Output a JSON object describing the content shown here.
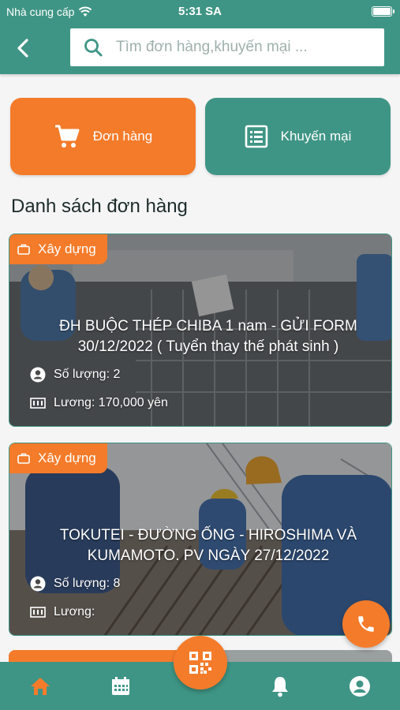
{
  "status_bar": {
    "carrier": "Nhà cung cấp",
    "time": "5:31 SA"
  },
  "header": {
    "search_placeholder": "Tìm đơn hàng,khuyến mại ..."
  },
  "quick_actions": {
    "orders_label": "Đơn hàng",
    "promotions_label": "Khuyến mại"
  },
  "section_title": "Danh sách đơn hàng",
  "orders": [
    {
      "category": "Xây dựng",
      "title": "ĐH BUỘC THÉP CHIBA 1 nam - GỬI FORM 30/12/2022 ( Tuyển thay thế phát sinh )",
      "quantity_label": "Số lượng: 2",
      "salary_label": "Lương: 170,000 yên"
    },
    {
      "category": "Xây dựng",
      "title": "TOKUTEI - ĐƯỜNG ỐNG - HIROSHIMA VÀ KUMAMOTO. PV NGÀY 27/12/2022",
      "quantity_label": "Số lượng: 8",
      "salary_label": "Lương:"
    }
  ],
  "colors": {
    "primary": "#3f9585",
    "accent": "#f47b2a"
  },
  "icons": {
    "back": "chevron-left-icon",
    "search": "search-icon",
    "cart": "cart-icon",
    "list": "list-icon",
    "briefcase": "briefcase-icon",
    "person": "person-icon",
    "money": "money-icon",
    "phone": "phone-icon",
    "qr": "qr-code-icon",
    "home": "home-icon",
    "calendar": "calendar-icon",
    "bell": "bell-icon",
    "account": "account-icon"
  }
}
